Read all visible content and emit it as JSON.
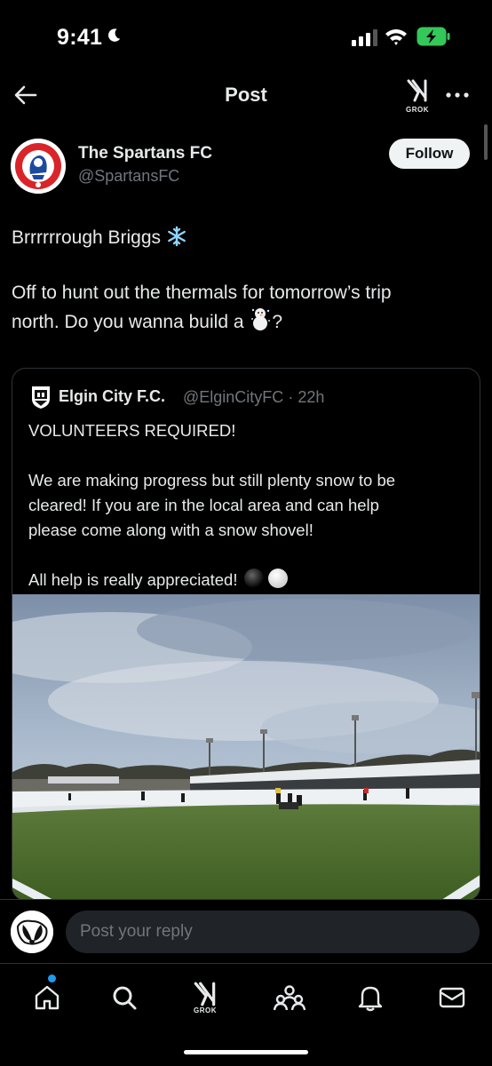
{
  "status_bar": {
    "time": "9:41",
    "icons": [
      "moon-icon",
      "signal-icon",
      "wifi-icon",
      "battery-charging-icon"
    ]
  },
  "header": {
    "title": "Post",
    "grok_label": "GROK",
    "icons": [
      "back-arrow-icon",
      "grok-icon",
      "more-icon"
    ]
  },
  "post": {
    "author_name": "The Spartans FC",
    "author_handle": "@SpartansFC",
    "follow_label": "Follow",
    "lines": [
      "Brrrrrrough Briggs ",
      "Off to hunt out the thermals for tomorrow’s trip",
      "north.  Do you wanna build a ",
      "?"
    ],
    "emojis": [
      "snowflake-emoji",
      "snowman-emoji"
    ]
  },
  "quote": {
    "author_name": "Elgin City F.C.",
    "author_handle": "@ElginCityFC",
    "separator": "·",
    "time": "22h",
    "lines": [
      "VOLUNTEERS REQUIRED!",
      "We are making progress but still plenty snow to be",
      "cleared! If you are in the local area and can help",
      "please come along with a snow shovel!",
      "All help is really appreciated! "
    ],
    "emojis": [
      "black-circle-emoji",
      "white-circle-emoji"
    ]
  },
  "reply": {
    "placeholder": "Post your reply"
  },
  "nav": {
    "grok_label": "GROK",
    "items": [
      "home",
      "search",
      "grok",
      "communities",
      "notifications",
      "messages"
    ]
  },
  "colors": {
    "background": "#000000",
    "text": "#e7e9ea",
    "muted": "#71767b",
    "border": "#2f3336",
    "accent": "#1d9bf0",
    "battery": "#34c759"
  }
}
